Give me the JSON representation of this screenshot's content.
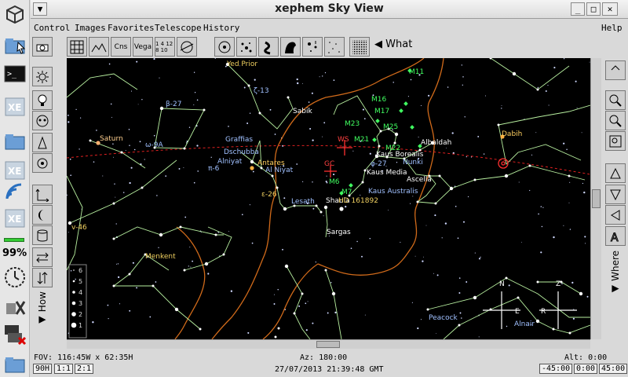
{
  "desktop": {
    "battery_percent": "99%"
  },
  "window": {
    "title": "xephem Sky View"
  },
  "menu": {
    "items": [
      "Control",
      "Images",
      "Favorites",
      "Telescope",
      "History"
    ],
    "help": "Help"
  },
  "toolbar": {
    "what_label": "What",
    "cns_label": "Cns",
    "vega_label": "Vega",
    "grid_numbers": "1 4 12 8 10"
  },
  "side": {
    "how_label": "How",
    "where_label": "Where"
  },
  "sky": {
    "mag_legend": [
      "6",
      "5",
      "4",
      "3",
      "2",
      "1"
    ],
    "labels": [
      {
        "text": "Yed Prior",
        "color": "#f0d060"
      },
      {
        "text": "ζ-13",
        "color": "#a0c0ff"
      },
      {
        "text": "β-27",
        "color": "#a0c0ff"
      },
      {
        "text": "Sabik",
        "color": "#ffffff"
      },
      {
        "text": "M11",
        "color": "#40ff60"
      },
      {
        "text": "M16",
        "color": "#40ff60"
      },
      {
        "text": "M17",
        "color": "#40ff60"
      },
      {
        "text": "M23",
        "color": "#40ff60"
      },
      {
        "text": "M25",
        "color": "#40ff60"
      },
      {
        "text": "M21",
        "color": "#40ff60"
      },
      {
        "text": "WS",
        "color": "#ff4040"
      },
      {
        "text": "Saturn",
        "color": "#ffd090"
      },
      {
        "text": "ω-9A",
        "color": "#a0c0ff"
      },
      {
        "text": "Graffias",
        "color": "#a0c0ff"
      },
      {
        "text": "Dschubba",
        "color": "#a0c0ff"
      },
      {
        "text": "Alniyat",
        "color": "#a0c0ff"
      },
      {
        "text": "π-6",
        "color": "#a0c0ff"
      },
      {
        "text": "Antares",
        "color": "#ffd060"
      },
      {
        "text": "Al Niyat",
        "color": "#a0c0ff"
      },
      {
        "text": "GC",
        "color": "#ff4040"
      },
      {
        "text": "M6",
        "color": "#40ff60"
      },
      {
        "text": "M22",
        "color": "#40ff60"
      },
      {
        "text": "Albaldah",
        "color": "#ffffff"
      },
      {
        "text": "Kaus Borealis",
        "color": "#ffffff"
      },
      {
        "text": "φ-27",
        "color": "#a0c0ff"
      },
      {
        "text": "Nunki",
        "color": "#a0c0ff"
      },
      {
        "text": "Kaus Media",
        "color": "#ffffff"
      },
      {
        "text": "Ascella",
        "color": "#ffffff"
      },
      {
        "text": "M7",
        "color": "#40ff60"
      },
      {
        "text": "Kaus Australis",
        "color": "#a0c0ff"
      },
      {
        "text": "ε-26",
        "color": "#f0d060"
      },
      {
        "text": "Lesath",
        "color": "#a0c0ff"
      },
      {
        "text": "Shaula",
        "color": "#ffffff"
      },
      {
        "text": "HD 161892",
        "color": "#f0d060"
      },
      {
        "text": "Sargas",
        "color": "#ffffff"
      },
      {
        "text": "Dabih",
        "color": "#ffd060"
      },
      {
        "text": "v-46",
        "color": "#f0d060"
      },
      {
        "text": "Menkent",
        "color": "#f0d060"
      },
      {
        "text": "Peacock",
        "color": "#a0c0ff"
      },
      {
        "text": "Alnair",
        "color": "#a0c0ff"
      }
    ],
    "compass": {
      "n": "N",
      "e": "E",
      "r": "R",
      "z": "Z"
    }
  },
  "status": {
    "fov": "FOV: 116:45W x  62:35H",
    "az": "Az: 180:00",
    "alt": "Alt:   0:00",
    "datetime": "27/07/2013  21:39:48 GMT",
    "boxes_left": [
      "90H",
      "1:1",
      "2:1"
    ],
    "boxes_right": [
      "-45:00",
      "0:00",
      "45:00"
    ]
  }
}
